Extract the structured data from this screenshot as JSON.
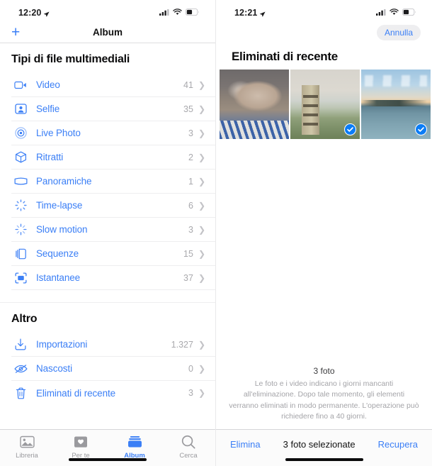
{
  "left": {
    "status": {
      "time": "12:20",
      "location_icon": "location-arrow-icon",
      "cellular_icon": "cellular-bars-icon",
      "wifi_icon": "wifi-icon",
      "battery_icon": "battery-icon"
    },
    "navbar": {
      "add_icon": "plus-icon",
      "title": "Album"
    },
    "sections": [
      {
        "title": "Tipi di file multimediali",
        "rows": [
          {
            "icon": "video-camera-icon",
            "label": "Video",
            "count": "41"
          },
          {
            "icon": "selfie-person-icon",
            "label": "Selfie",
            "count": "35"
          },
          {
            "icon": "live-photo-icon",
            "label": "Live Photo",
            "count": "3"
          },
          {
            "icon": "portrait-cube-icon",
            "label": "Ritratti",
            "count": "2"
          },
          {
            "icon": "panorama-icon",
            "label": "Panoramiche",
            "count": "1"
          },
          {
            "icon": "timelapse-icon",
            "label": "Time-lapse",
            "count": "6"
          },
          {
            "icon": "slow-motion-icon",
            "label": "Slow motion",
            "count": "3"
          },
          {
            "icon": "burst-stack-icon",
            "label": "Sequenze",
            "count": "15"
          },
          {
            "icon": "screenshot-icon",
            "label": "Istantanee",
            "count": "37"
          }
        ]
      },
      {
        "title": "Altro",
        "rows": [
          {
            "icon": "import-icon",
            "label": "Importazioni",
            "count": "1.327"
          },
          {
            "icon": "hidden-eye-icon",
            "label": "Nascosti",
            "count": "0"
          },
          {
            "icon": "trash-icon",
            "label": "Eliminati di recente",
            "count": "3"
          }
        ]
      }
    ],
    "tabs": [
      {
        "icon": "photo-library-icon",
        "label": "Libreria",
        "active": false
      },
      {
        "icon": "for-you-icon",
        "label": "Per te",
        "active": false
      },
      {
        "icon": "albums-icon",
        "label": "Album",
        "active": true
      },
      {
        "icon": "search-icon",
        "label": "Cerca",
        "active": false
      }
    ]
  },
  "right": {
    "status": {
      "time": "12:21",
      "location_icon": "location-arrow-icon",
      "cellular_icon": "cellular-bars-icon",
      "wifi_icon": "wifi-icon",
      "battery_icon": "battery-icon"
    },
    "cancel_label": "Annulla",
    "title": "Eliminati di recente",
    "photos": [
      {
        "name": "photo-cat",
        "selected": true
      },
      {
        "name": "photo-town",
        "selected": true
      },
      {
        "name": "photo-sea",
        "selected": true
      }
    ],
    "footnote_count": "3 foto",
    "footnote_desc": "Le foto e i video indicano i giorni mancanti all'eliminazione. Dopo tale momento, gli elementi verranno eliminati in modo permanente. L'operazione può richiedere fino a 40 giorni.",
    "actions": {
      "delete_label": "Elimina",
      "status_label": "3 foto selezionate",
      "recover_label": "Recupera"
    }
  },
  "colors": {
    "accent": "#3b7ff6",
    "check_blue": "#0a7cf6",
    "count_gray": "#a9a9ad"
  }
}
